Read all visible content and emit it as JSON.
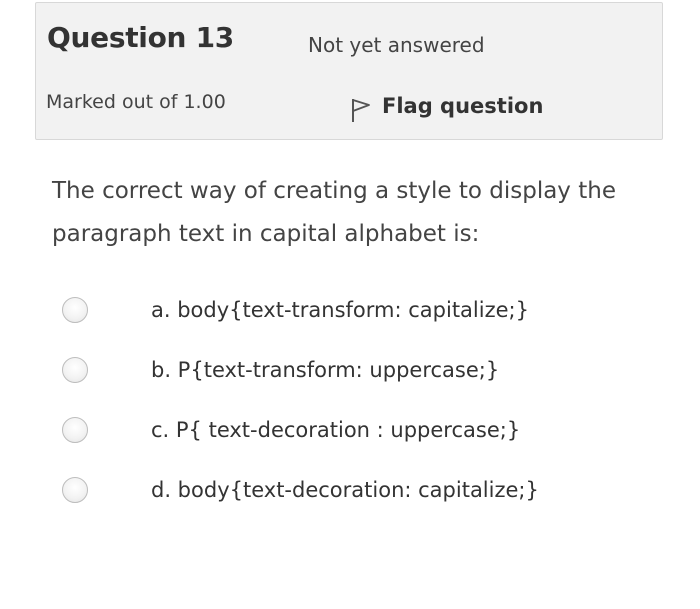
{
  "header": {
    "question_number": "Question 13",
    "state": "Not yet answered",
    "grade": "Marked out of 1.00",
    "flag_label": "Flag question",
    "flag_icon": "flag-icon"
  },
  "question": {
    "text": "The correct way of creating a style to display the paragraph text in capital alphabet is:"
  },
  "answers": [
    {
      "label": "a. body{text-transform: capitalize;}",
      "selected": false
    },
    {
      "label": "b. P{text-transform: uppercase;}",
      "selected": false
    },
    {
      "label": "c. P{ text-decoration : uppercase;}",
      "selected": false
    },
    {
      "label": "d. body{text-decoration: capitalize;}",
      "selected": false
    }
  ],
  "colors": {
    "info_background": "#f2f2f2",
    "info_border": "#d8d8d8",
    "text": "#333333"
  }
}
